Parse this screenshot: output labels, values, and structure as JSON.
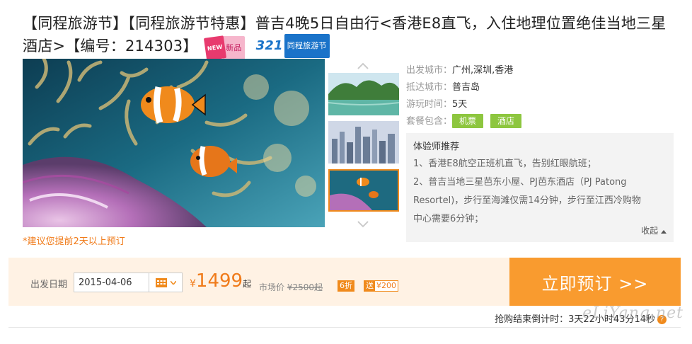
{
  "title": {
    "text": "【同程旅游节】【同程旅游节特惠】普吉4晚5日自由行<香港E8直飞，入住地理位置绝佳当地三星酒店>【编号：214303】",
    "badge_new_box": "NEW",
    "badge_new_text": "新品",
    "badge_321_num": "321",
    "badge_321_text": "同程旅游节"
  },
  "gallery": {
    "up_arrow": "︿",
    "down_arrow": "﹀",
    "thumbs": [
      "karst-island-lagoon",
      "hong-kong-city-skyline",
      "clownfish-anemone"
    ],
    "active_index": 2
  },
  "booking_note": "*建议您提前2天以上预订",
  "info": {
    "departure_label": "出发城市：",
    "departure_value": "广州,深圳,香港",
    "arrival_label": "抵达城市：",
    "arrival_value": "普吉岛",
    "duration_label": "游玩时间：",
    "duration_value": "5天",
    "package_label": "套餐包含：",
    "package_items": [
      "机票",
      "酒店"
    ]
  },
  "recommend": {
    "title": "体验师推荐",
    "lines": [
      "1、香港E8航空正班机直飞，告别红眼航班；",
      "2、普吉当地三星芭东小屋、PJ芭东酒店（PJ Patong",
      "Resortel)，步行至海滩仅需14分钟，步行至江西冷购物",
      "中心需要6分钟；"
    ],
    "collapse_label": "收起"
  },
  "booking": {
    "date_label": "出发日期",
    "date_value": "2015-04-06",
    "price_symbol": "¥",
    "price_value": "1499",
    "price_unit": "起",
    "market_label": "市场价",
    "market_value": "¥2500起",
    "discount_tag": "6折",
    "gift_label": "送",
    "gift_value": "¥200",
    "book_button": "立即预订 >>"
  },
  "countdown": {
    "label": "抢购结束倒计时：",
    "value": "3天22小时43分14秒"
  },
  "watermark": "eLiYang.net",
  "colors": {
    "accent": "#f99b2f",
    "price": "#f07b1a",
    "tag_green": "#8dc63f",
    "badge_blue": "#1a73c9",
    "badge_pink": "#e83a6e"
  }
}
